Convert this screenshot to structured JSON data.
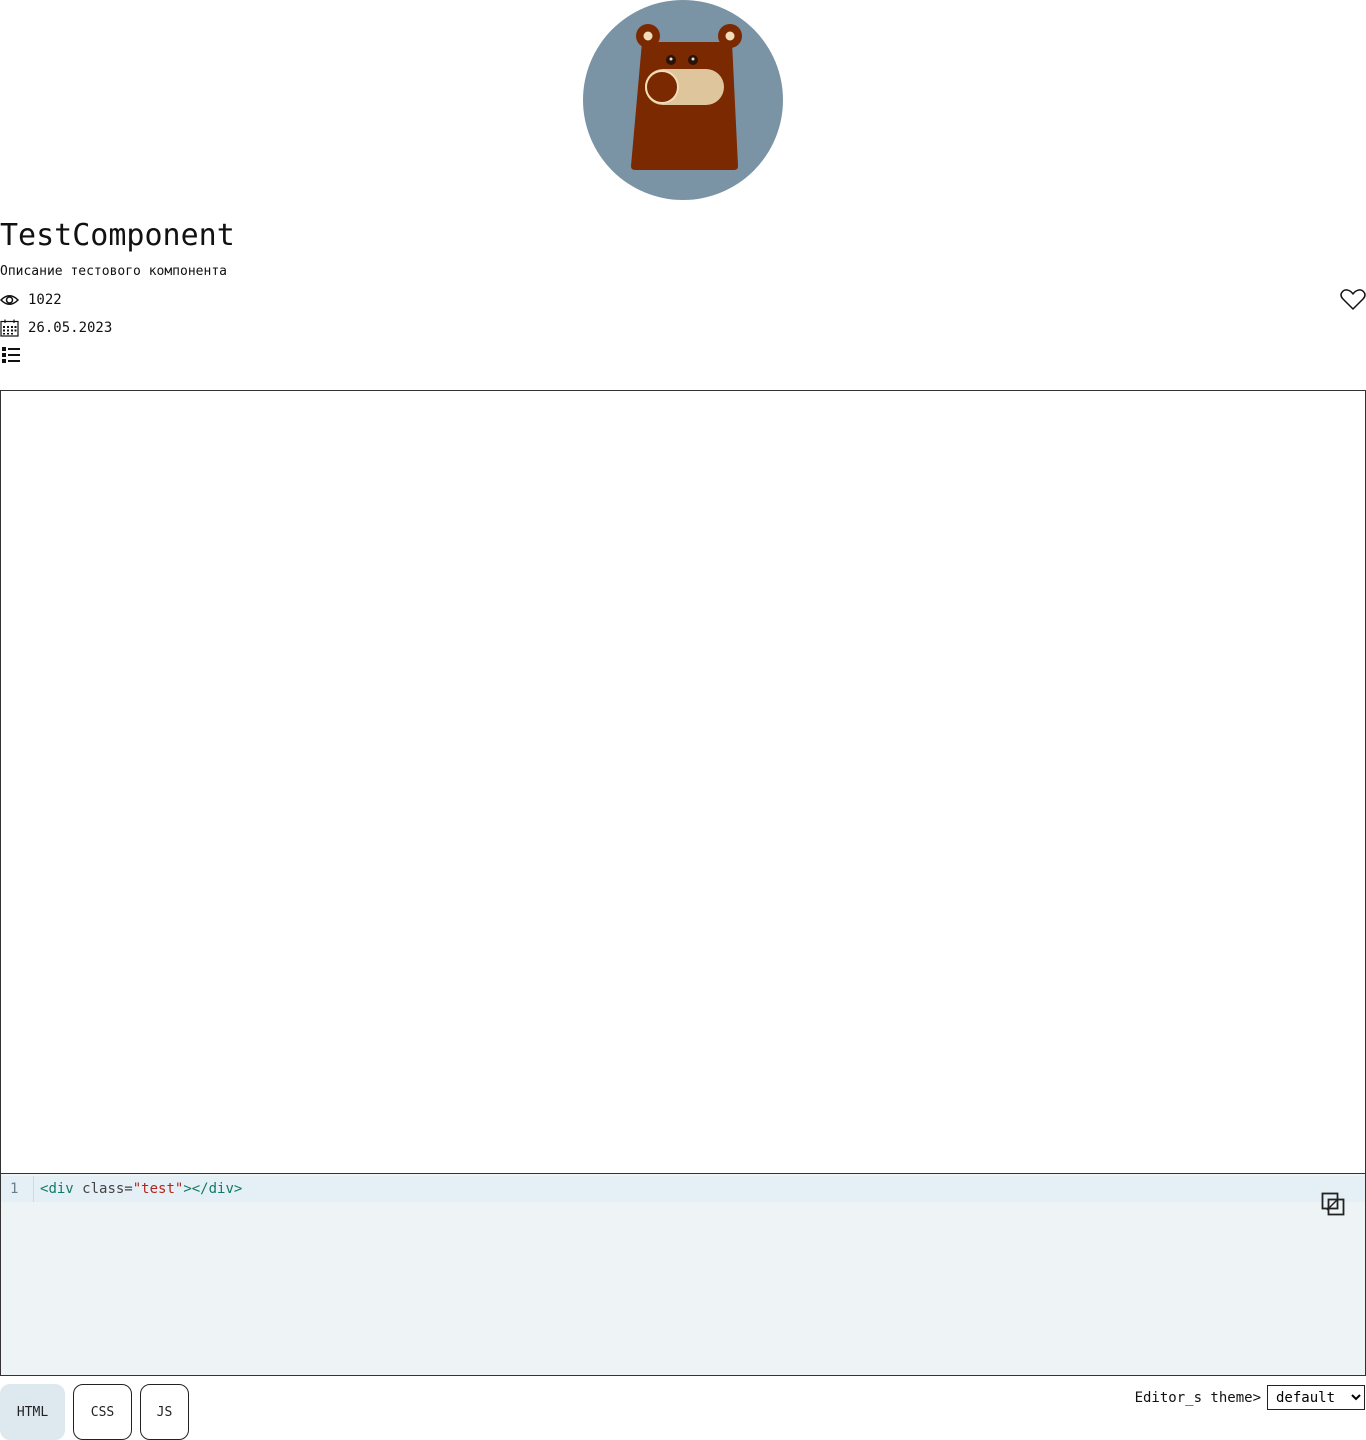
{
  "component": {
    "title": "TestComponent",
    "description": "Описание тестового компонента",
    "views": "1022",
    "date": "26.05.2023"
  },
  "icons": {
    "logo": "bear-toggle-logo",
    "views": "eye-icon",
    "date": "calendar-icon",
    "list": "list-icon",
    "like": "heart-icon",
    "copy": "copy-icon"
  },
  "editor": {
    "line_number": "1",
    "code": {
      "open_bracket": "<",
      "tag": "div",
      "attr": " class=",
      "value": "\"test\"",
      "close_open": "></",
      "close_tag": "div",
      "close_bracket": ">"
    }
  },
  "tabs": [
    "HTML",
    "CSS",
    "JS"
  ],
  "active_tab": "HTML",
  "theme": {
    "label": "Editor_s theme>",
    "selected": "default"
  },
  "colors": {
    "logo_bg": "#7a94a6",
    "bear_body": "#7b2900",
    "bear_snout": "#dec59c",
    "editor_bg": "#eef3f6",
    "active_tab_bg": "#dde9ee"
  }
}
